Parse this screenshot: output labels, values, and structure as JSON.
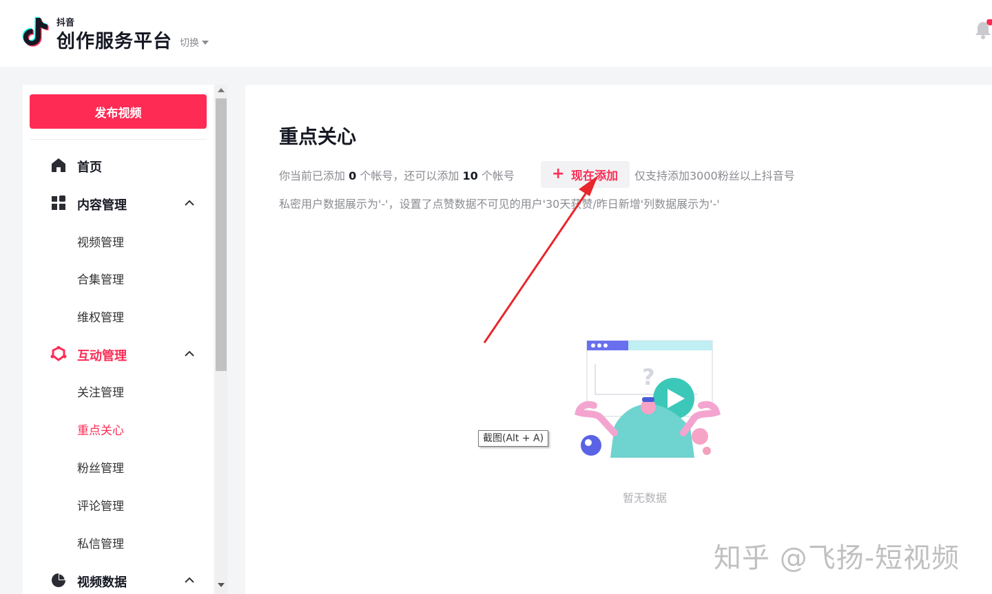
{
  "header": {
    "brand_small": "抖音",
    "brand_name": "创作服务平台",
    "switch_label": "切换"
  },
  "sidebar": {
    "publish_label": "发布视频",
    "nav": [
      {
        "label": "首页",
        "icon": "home-icon"
      },
      {
        "label": "内容管理",
        "icon": "grid-icon",
        "expanded": true
      },
      {
        "label": "视频管理"
      },
      {
        "label": "合集管理"
      },
      {
        "label": "维权管理"
      },
      {
        "label": "互动管理",
        "icon": "interact-icon",
        "expanded": true,
        "active": true
      },
      {
        "label": "关注管理"
      },
      {
        "label": "重点关心",
        "current": true
      },
      {
        "label": "粉丝管理"
      },
      {
        "label": "评论管理"
      },
      {
        "label": "私信管理"
      },
      {
        "label": "视频数据",
        "icon": "pie-chart-icon",
        "expanded": true
      }
    ]
  },
  "main": {
    "title": "重点关心",
    "info_prefix": "你当前已添加",
    "added_count": "0",
    "info_middle": "个帐号，还可以添加",
    "remaining_count": "10",
    "info_suffix": "个帐号",
    "add_button_label": "现在添加",
    "support_note": "仅支持添加3000粉丝以上抖音号",
    "privacy_note": "私密用户数据展示为'-'，设置了点赞数据不可见的用户'30天获赞/昨日新增'列数据展示为'-'",
    "empty_text": "暂无数据"
  },
  "tooltip": "截图(Alt + A)",
  "watermark": "知乎 @飞扬-短视频",
  "colors": {
    "accent": "#fe2c55",
    "annotation_arrow": "#e8262b"
  }
}
